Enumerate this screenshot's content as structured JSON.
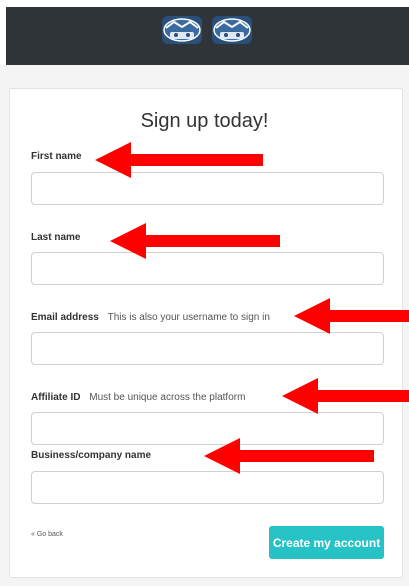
{
  "header": {
    "logos": [
      {
        "icon": "team-logo-icon"
      },
      {
        "icon": "team-logo-icon"
      }
    ]
  },
  "form": {
    "title": "Sign up today!",
    "fields": [
      {
        "label": "First name",
        "hint": "",
        "value": "",
        "placeholder": ""
      },
      {
        "label": "Last name",
        "hint": "",
        "value": "",
        "placeholder": ""
      },
      {
        "label": "Email address",
        "hint": "This is also your username to sign in",
        "value": "",
        "placeholder": ""
      },
      {
        "label": "Affiliate ID",
        "hint": "Must be unique across the platform",
        "value": "",
        "placeholder": ""
      },
      {
        "label": "Business/company name",
        "hint": "",
        "value": "",
        "placeholder": ""
      }
    ],
    "go_back_label": "« Go back",
    "submit_label": "Create my account"
  },
  "annotations": {
    "arrow_color": "#ff0000"
  },
  "colors": {
    "header_bg": "#2f3439",
    "button_bg": "#27c2c6"
  }
}
